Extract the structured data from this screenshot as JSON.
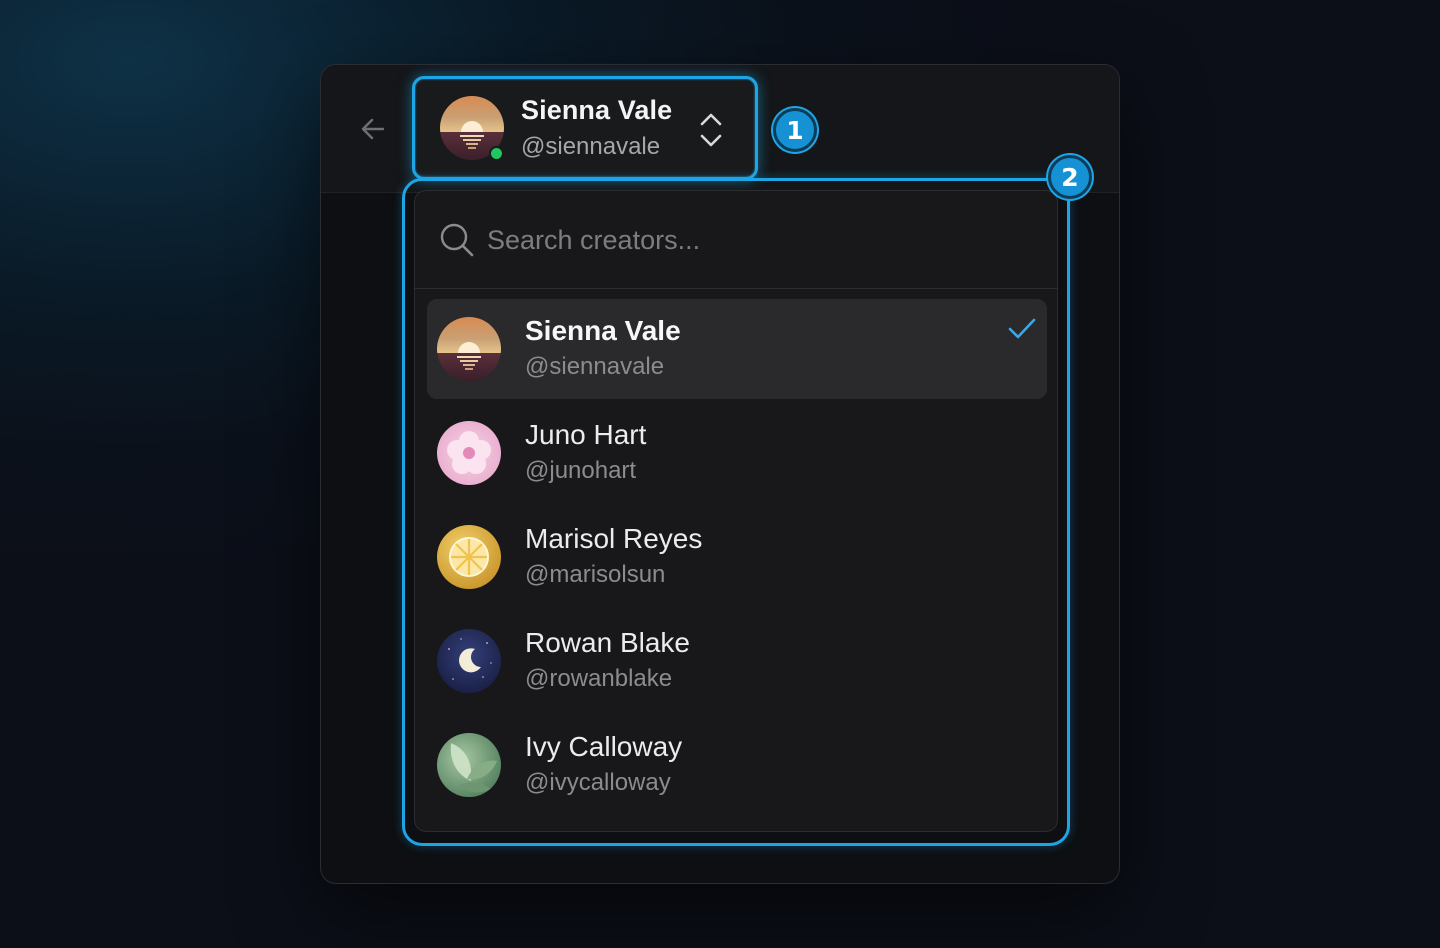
{
  "header": {
    "back_icon": "arrow-left-icon",
    "current_account": {
      "name": "Sienna Vale",
      "handle": "@siennavale",
      "status": "online",
      "status_color": "#22c55e",
      "avatar_icon": "sunset-avatar",
      "toggle_icon": "chevron-up-down-icon"
    }
  },
  "annotations": {
    "badge_1": "1",
    "badge_2": "2",
    "accent_color": "#1ea5e6"
  },
  "dropdown": {
    "search": {
      "placeholder": "Search creators...",
      "value": "",
      "icon": "search-icon"
    },
    "creators": [
      {
        "name": "Sienna Vale",
        "handle": "@siennavale",
        "avatar_icon": "sunset-avatar",
        "selected": true,
        "check_icon": "check-icon"
      },
      {
        "name": "Juno Hart",
        "handle": "@junohart",
        "avatar_icon": "flower-avatar",
        "selected": false
      },
      {
        "name": "Marisol Reyes",
        "handle": "@marisolsun",
        "avatar_icon": "citrus-avatar",
        "selected": false
      },
      {
        "name": "Rowan Blake",
        "handle": "@rowanblake",
        "avatar_icon": "moon-avatar",
        "selected": false
      },
      {
        "name": "Ivy Calloway",
        "handle": "@ivycalloway",
        "avatar_icon": "leaf-avatar",
        "selected": false
      }
    ]
  }
}
